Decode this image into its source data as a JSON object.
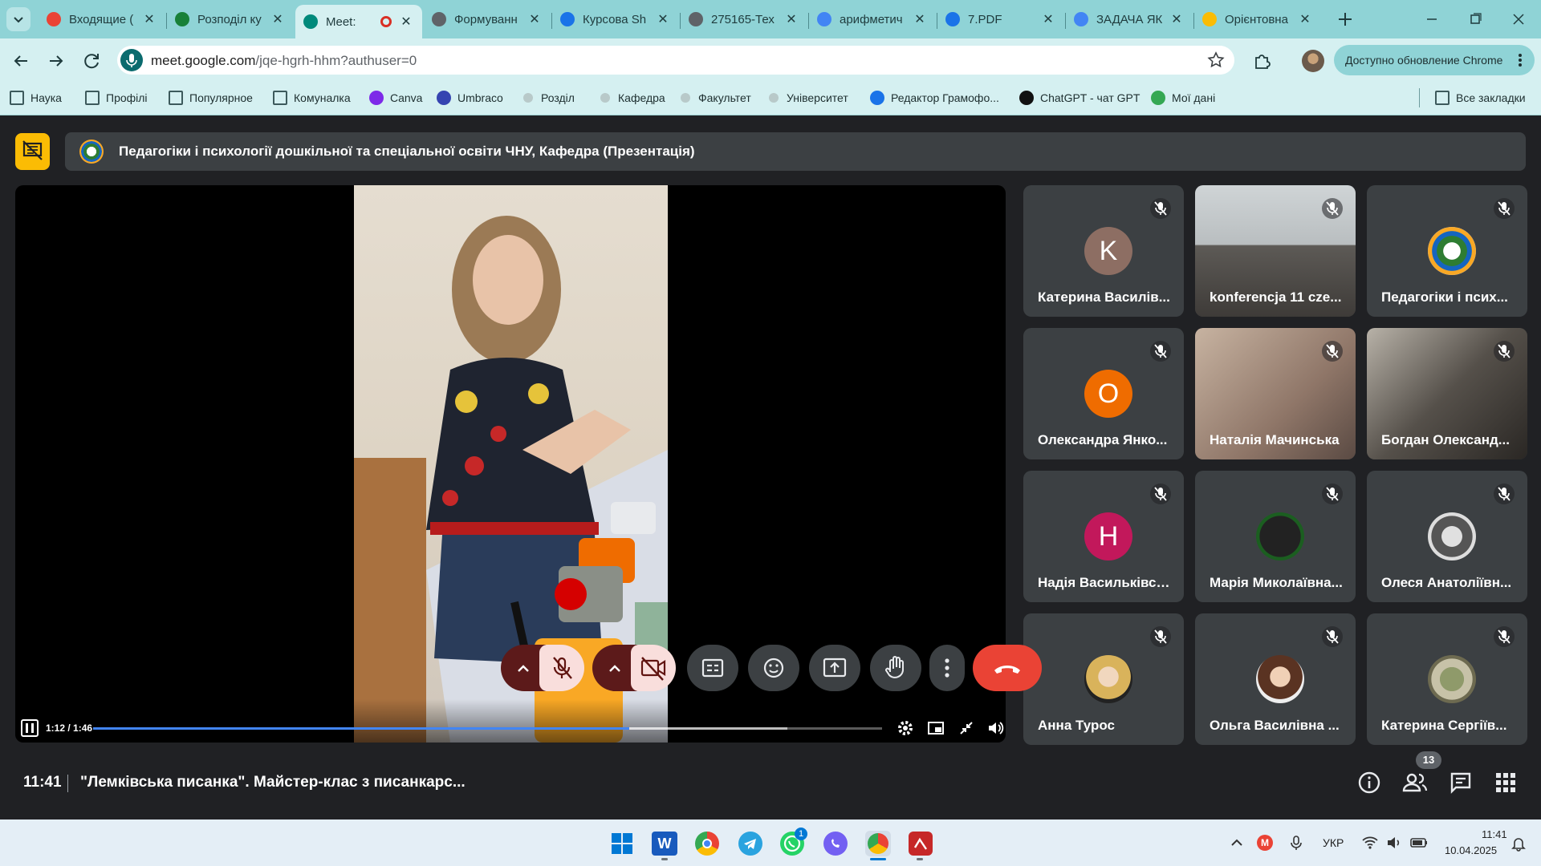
{
  "browser": {
    "tabs": [
      {
        "title": "Входящие (",
        "favicon": "gmail-icon",
        "color": "#ea4335"
      },
      {
        "title": "Розподіл ку",
        "favicon": "sheets-icon",
        "color": "#188038"
      },
      {
        "title": "Meet: ",
        "favicon": "meet-icon",
        "color": "#00897b",
        "active": true
      },
      {
        "title": "Формуванн",
        "favicon": "globe-icon",
        "color": "#5f6368"
      },
      {
        "title": "Курсова Sh",
        "favicon": "doc-icon",
        "color": "#1a73e8"
      },
      {
        "title": "275165-Тех",
        "favicon": "globe-icon",
        "color": "#5f6368"
      },
      {
        "title": "арифметич",
        "favicon": "google-icon",
        "color": "#4285f4"
      },
      {
        "title": "7.PDF",
        "favicon": "doc-icon",
        "color": "#1a73e8"
      },
      {
        "title": "ЗАДАЧА ЯК",
        "favicon": "google-icon",
        "color": "#4285f4"
      },
      {
        "title": "Орієнтовна",
        "favicon": "drive-icon",
        "color": "#fbbc04"
      }
    ],
    "url_host": "meet.google.com",
    "url_path": "/jqe-hgrh-hhm?authuser=0",
    "update_label": "Доступно обновление Chrome",
    "bookmarks": [
      {
        "label": "Наука",
        "icon": "folder-icon"
      },
      {
        "label": "Профілі",
        "icon": "folder-icon"
      },
      {
        "label": "Популярное",
        "icon": "folder-icon"
      },
      {
        "label": "Комуналка",
        "icon": "folder-icon"
      },
      {
        "label": "Canva",
        "icon": "canva-icon",
        "color": "#7d2ae8"
      },
      {
        "label": "Umbraco",
        "icon": "umbraco-icon",
        "color": "#3544b1"
      },
      {
        "label": "Розділ",
        "icon": "dot-icon"
      },
      {
        "label": "Кафедра",
        "icon": "dot-icon"
      },
      {
        "label": "Факультет",
        "icon": "dot-icon"
      },
      {
        "label": "Університет",
        "icon": "dot-icon"
      },
      {
        "label": "Редактор Грамофо...",
        "icon": "grammar-icon",
        "color": "#1a73e8"
      },
      {
        "label": "ChatGPT - чат GPT",
        "icon": "chatgpt-icon",
        "color": "#111111"
      },
      {
        "label": "Мої дані",
        "icon": "globe-icon",
        "color": "#34a853"
      }
    ],
    "all_bookmarks": "Все закладки"
  },
  "meet": {
    "presenter_title": "Педагогіки і психології дошкільної та спеціальної освіти ЧНУ, Кафедра (Презентація)",
    "video": {
      "time": "1:12 / 1:46",
      "progress": 0.68,
      "buffered": 0.88
    },
    "participants": [
      {
        "name": "Катерина Василів...",
        "initial": "K",
        "color": "#8d6e63"
      },
      {
        "name": "konferencja 11 cze...",
        "photo": "classroom"
      },
      {
        "name": "Педагогіки і псих...",
        "photo": "emblem"
      },
      {
        "name": "Олександра Янко...",
        "initial": "O",
        "color": "#ef6c00"
      },
      {
        "name": "Наталія Мачинська",
        "photo": "woman-glasses"
      },
      {
        "name": "Богдан Олександ...",
        "photo": "room"
      },
      {
        "name": "Надія Васильківсь...",
        "initial": "H",
        "color": "#c2185b"
      },
      {
        "name": "Марія Миколаївна...",
        "photo": "portrait-dark"
      },
      {
        "name": "Олеся Анатоліївн...",
        "photo": "portrait-bw"
      },
      {
        "name": "Анна Турос",
        "photo": "portrait-blonde"
      },
      {
        "name": "Ольга Василівна ...",
        "photo": "portrait-brunette"
      },
      {
        "name": "Катерина Сергіїв...",
        "photo": "landscape"
      }
    ],
    "clock": "11:41",
    "meeting_title": "\"Лемківська писанка\". Майстер-клас з писанкарс...",
    "participants_count": "13",
    "accent": "#8ab4f8",
    "danger": "#ea4335"
  },
  "taskbar": {
    "lang": "УКР",
    "time": "11:41",
    "date": "10.04.2025",
    "whatsapp_badge": "1"
  }
}
